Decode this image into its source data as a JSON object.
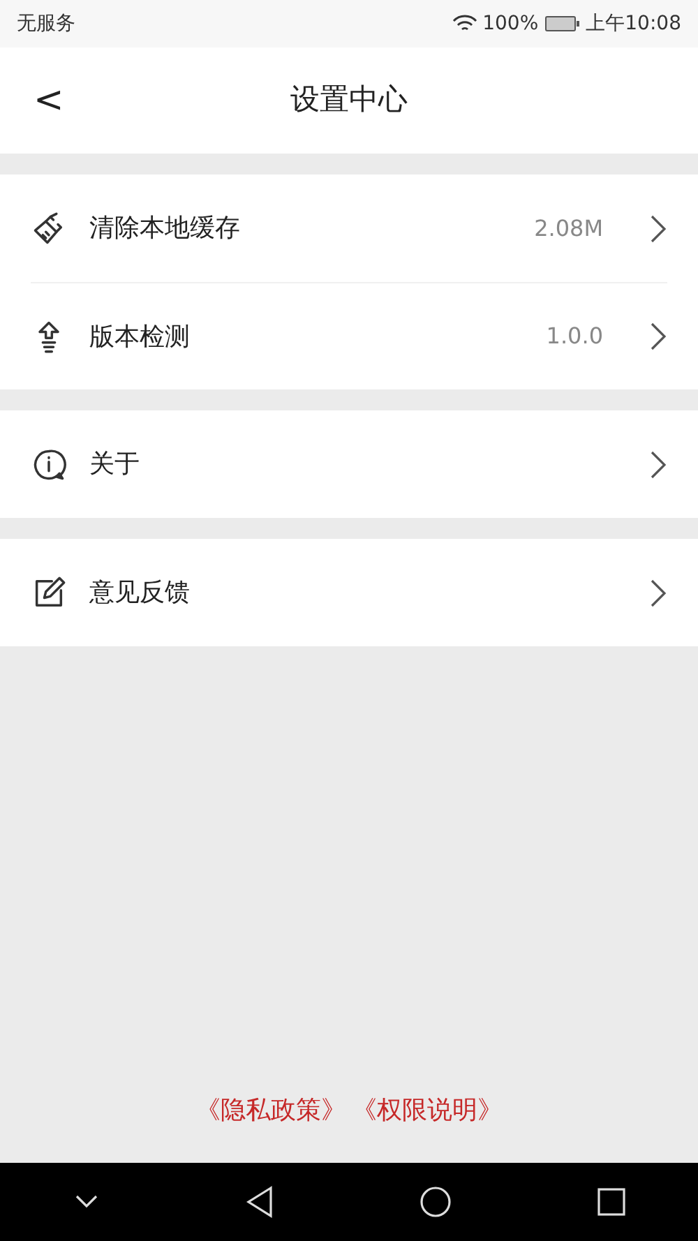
{
  "status_bar": {
    "carrier": "无服务",
    "battery": "100%",
    "time": "上午10:08"
  },
  "header": {
    "back": "<",
    "title": "设置中心"
  },
  "groups": [
    {
      "items": [
        {
          "kind": "clean",
          "label": "清除本地缓存",
          "value": "2.08M"
        },
        {
          "kind": "update",
          "label": "版本检测",
          "value": "1.0.0"
        }
      ]
    },
    {
      "items": [
        {
          "kind": "about",
          "label": "关于"
        }
      ]
    },
    {
      "items": [
        {
          "kind": "feedback",
          "label": "意见反馈"
        }
      ]
    }
  ],
  "footer_links": [
    "《隐私政策》",
    "《权限说明》"
  ]
}
